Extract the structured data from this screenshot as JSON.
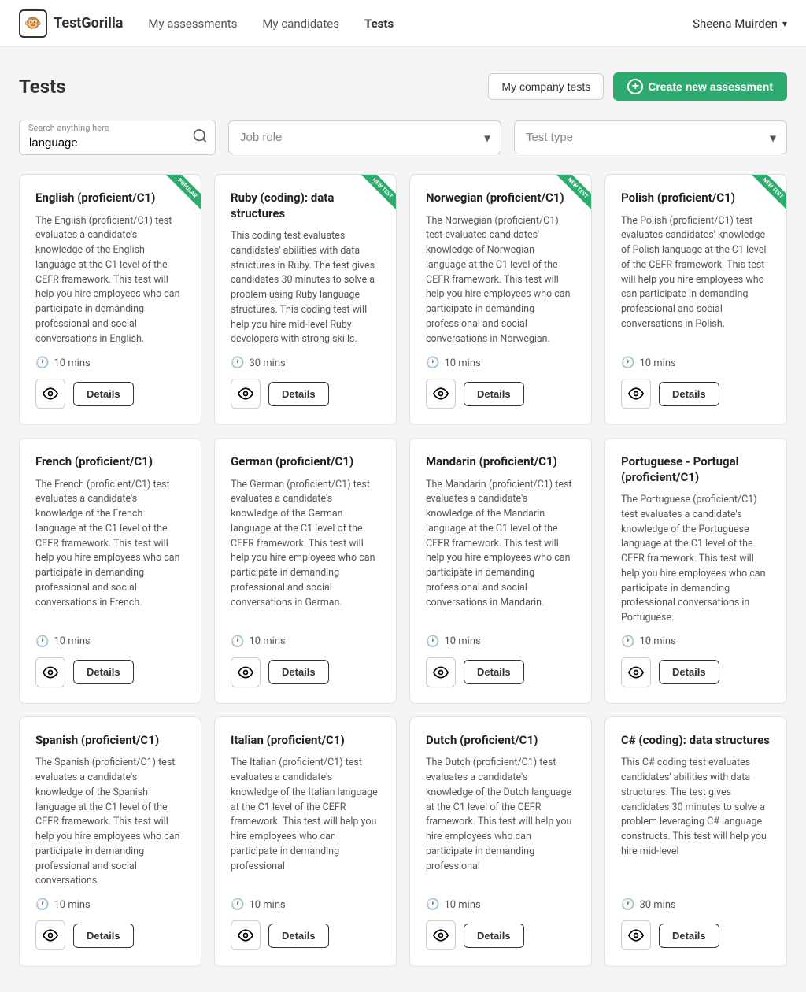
{
  "navbar": {
    "logo_text": "TestGorilla",
    "nav_items": [
      {
        "label": "My assessments",
        "active": false
      },
      {
        "label": "My candidates",
        "active": false
      },
      {
        "label": "Tests",
        "active": true
      }
    ],
    "user_name": "Sheena Muirden"
  },
  "page": {
    "title": "Tests",
    "btn_company_tests": "My company tests",
    "btn_create": "Create new assessment"
  },
  "filters": {
    "search_label": "Search anything here",
    "search_value": "language",
    "search_placeholder": "",
    "job_role_placeholder": "Job role",
    "test_type_placeholder": "Test type"
  },
  "cards": [
    {
      "title": "English (proficient/C1)",
      "badge": "POPULAR",
      "badge_type": "popular",
      "description": "The English (proficient/C1) test evaluates a candidate's knowledge of the English language at the C1 level of the CEFR framework. This test will help you hire employees who can participate in demanding professional and social conversations in English.",
      "duration": "10 mins"
    },
    {
      "title": "Ruby (coding): data structures",
      "badge": "NEW TEST",
      "badge_type": "new",
      "description": "This coding test evaluates candidates' abilities with data structures in Ruby. The test gives candidates 30 minutes to solve a problem using Ruby language structures. This coding test will help you hire mid-level Ruby developers with strong skills.",
      "duration": "30 mins"
    },
    {
      "title": "Norwegian (proficient/C1)",
      "badge": "NEW TEST",
      "badge_type": "new",
      "description": "The Norwegian (proficient/C1) test evaluates candidates' knowledge of Norwegian language at the C1 level of the CEFR framework. This test will help you hire employees who can participate in demanding professional and social conversations in Norwegian.",
      "duration": "10 mins"
    },
    {
      "title": "Polish (proficient/C1)",
      "badge": "NEW TEST",
      "badge_type": "new",
      "description": "The Polish (proficient/C1) test evaluates candidates' knowledge of Polish language at the C1 level of the CEFR framework. This test will help you hire employees who can participate in demanding professional and social conversations in Polish.",
      "duration": "10 mins"
    },
    {
      "title": "French (proficient/C1)",
      "badge": "",
      "badge_type": "",
      "description": "The French (proficient/C1) test evaluates a candidate's knowledge of the French language at the C1 level of the CEFR framework. This test will help you hire employees who can participate in demanding professional and social conversations in French.",
      "duration": "10 mins"
    },
    {
      "title": "German (proficient/C1)",
      "badge": "",
      "badge_type": "",
      "description": "The German (proficient/C1) test evaluates a candidate's knowledge of the German language at the C1 level of the CEFR framework. This test will help you hire employees who can participate in demanding professional and social conversations in German.",
      "duration": "10 mins"
    },
    {
      "title": "Mandarin (proficient/C1)",
      "badge": "",
      "badge_type": "",
      "description": "The Mandarin (proficient/C1) test evaluates a candidate's knowledge of the Mandarin language at the C1 level of the CEFR framework. This test will help you hire employees who can participate in demanding professional and social conversations in Mandarin.",
      "duration": "10 mins"
    },
    {
      "title": "Portuguese - Portugal (proficient/C1)",
      "badge": "",
      "badge_type": "",
      "description": "The Portuguese (proficient/C1) test evaluates a candidate's knowledge of the Portuguese language at the C1 level of the CEFR framework. This test will help you hire employees who can participate in demanding professional conversations in Portuguese.",
      "duration": "10 mins"
    },
    {
      "title": "Spanish (proficient/C1)",
      "badge": "",
      "badge_type": "",
      "description": "The Spanish (proficient/C1) test evaluates a candidate's knowledge of the Spanish language at the C1 level of the CEFR framework. This test will help you hire employees who can participate in demanding professional and social conversations",
      "duration": "10 mins"
    },
    {
      "title": "Italian (proficient/C1)",
      "badge": "",
      "badge_type": "",
      "description": "The Italian (proficient/C1) test evaluates a candidate's knowledge of the Italian language at the C1 level of the CEFR framework. This test will help you hire employees who can participate in demanding professional",
      "duration": "10 mins"
    },
    {
      "title": "Dutch (proficient/C1)",
      "badge": "",
      "badge_type": "",
      "description": "The Dutch (proficient/C1) test evaluates a candidate's knowledge of the Dutch language at the C1 level of the CEFR framework. This test will help you hire employees who can participate in demanding professional",
      "duration": "10 mins"
    },
    {
      "title": "C# (coding): data structures",
      "badge": "",
      "badge_type": "",
      "description": "This C# coding test evaluates candidates' abilities with data structures. The test gives candidates 30 minutes to solve a problem leveraging C# language constructs. This test will help you hire mid-level",
      "duration": "30 mins"
    }
  ],
  "labels": {
    "details": "Details",
    "mins_suffix": "mins"
  }
}
